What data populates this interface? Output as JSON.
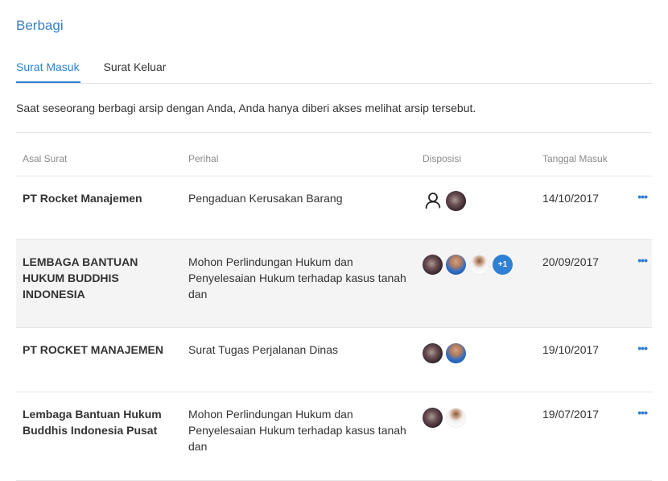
{
  "header": {
    "title": "Berbagi"
  },
  "tabs": [
    {
      "label": "Surat Masuk",
      "active": true
    },
    {
      "label": "Surat Keluar",
      "active": false
    }
  ],
  "notice": "Saat seseorang berbagi arsip dengan Anda, Anda hanya diberi akses melihat arsip tersebut.",
  "table": {
    "columns": [
      "Asal Surat",
      "Perihal",
      "Disposisi",
      "Tanggal Masuk"
    ],
    "rows": [
      {
        "asal": "PT Rocket Manajemen",
        "perihal": "Pengaduan Kerusakan Barang",
        "tanggal": "14/10/2017",
        "disposisi": [
          "person-icon",
          "avatar-dark"
        ]
      },
      {
        "asal": "LEMBAGA BANTUAN HUKUM BUDDHIS INDONESIA",
        "perihal": "Mohon Perlindungan Hukum dan Penyelesaian Hukum terhadap kasus tanah dan",
        "tanggal": "20/09/2017",
        "disposisi": [
          "avatar-dark",
          "avatar-blue",
          "avatar-white"
        ],
        "more_count": "+1"
      },
      {
        "asal": "PT ROCKET MANAJEMEN",
        "perihal": "Surat Tugas Perjalanan Dinas",
        "tanggal": "19/10/2017",
        "disposisi": [
          "avatar-dark",
          "avatar-blue"
        ]
      },
      {
        "asal": "Lembaga Bantuan Hukum Buddhis Indonesia Pusat",
        "perihal": "Mohon Perlindungan Hukum dan Penyelesaian Hukum terhadap kasus tanah dan",
        "tanggal": "19/07/2017",
        "disposisi": [
          "avatar-dark",
          "avatar-white"
        ]
      }
    ],
    "row_action": "•••"
  },
  "colors": {
    "accent": "#2f7fd4",
    "title": "#3a7fc1",
    "row_highlight": "#f4f4f4"
  }
}
